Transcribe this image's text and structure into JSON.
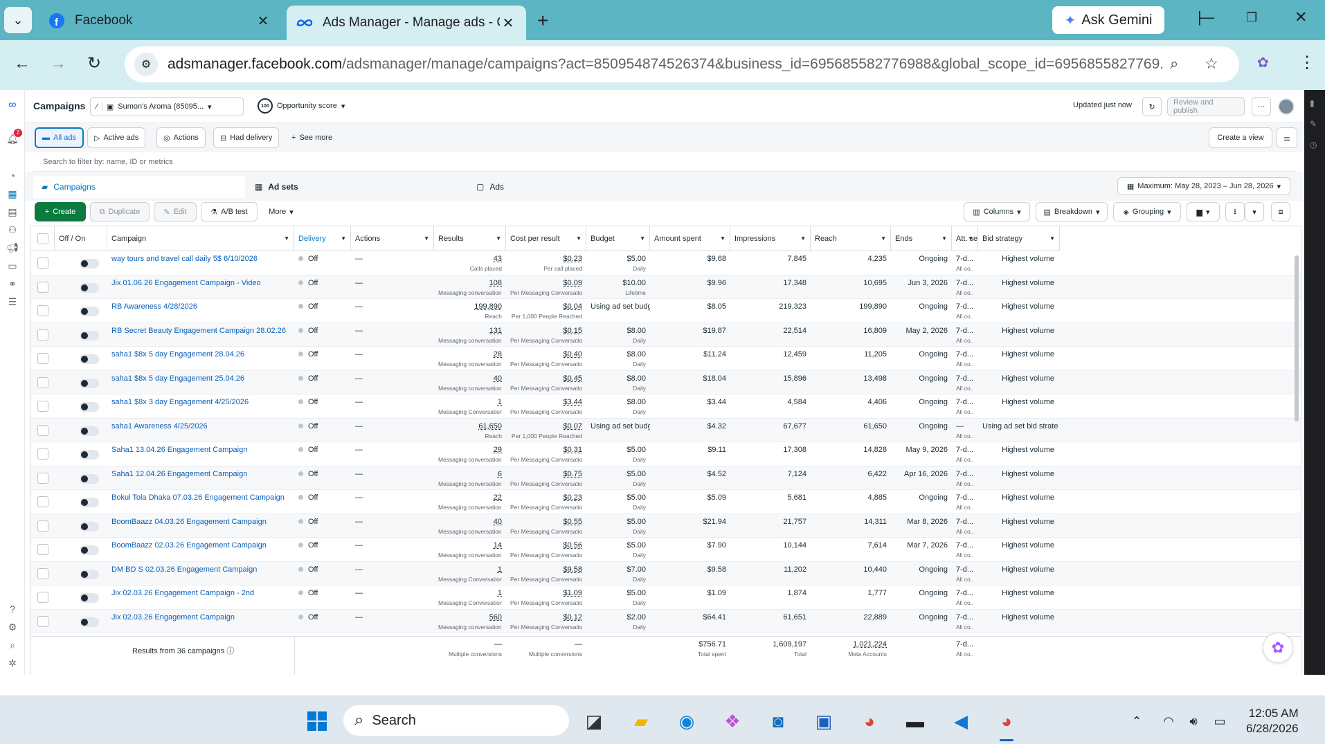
{
  "browser": {
    "tabs": [
      {
        "title": "Facebook"
      },
      {
        "title": "Ads Manager - Manage ads - C"
      }
    ],
    "gemini": "Ask Gemini",
    "url_domain": "adsmanager.facebook.com",
    "url_path": "/adsmanager/manage/campaigns?act=850954874526374&business_id=695685582776988&global_scope_id=6956855827769..."
  },
  "header": {
    "title": "Campaigns",
    "account": "Sumon's Aroma (85095...",
    "score_badge": "100",
    "opportunity": "Opportunity score",
    "updated": "Updated just now",
    "review": "Review and publish",
    "more": "···",
    "notif_count": "2"
  },
  "filters": {
    "all_ads": "All ads",
    "active_ads": "Active ads",
    "actions": "Actions",
    "had_delivery": "Had delivery",
    "see_more": "See more",
    "create_view": "Create a view",
    "search_placeholder": "Search to filter by: name, ID or metrics"
  },
  "levels": {
    "campaigns": "Campaigns",
    "adsets": "Ad sets",
    "ads": "Ads",
    "date": "Maximum: May 28, 2023 – Jun 28, 2026"
  },
  "toolbar": {
    "create": "Create",
    "duplicate": "Duplicate",
    "edit": "Edit",
    "abtest": "A/B test",
    "more": "More",
    "columns": "Columns",
    "breakdown": "Breakdown",
    "grouping": "Grouping"
  },
  "columns": [
    "Off / On",
    "Campaign",
    "Delivery",
    "Actions",
    "Results",
    "Cost per result",
    "Budget",
    "Amount spent",
    "Impressions",
    "Reach",
    "Ends",
    "Att. set...",
    "Bid strategy"
  ],
  "rows": [
    {
      "campaign": "way tours and travel call daily 5$ 6/10/2026",
      "delivery": "Off",
      "actions": "—",
      "results": "43",
      "results_sub": "Calls placed",
      "cpr": "$0.23",
      "cpr_sub": "Per call placed",
      "budget": "$5.00",
      "budget_sub": "Daily",
      "spent": "$9.68",
      "impr": "7,845",
      "reach": "4,235",
      "ends": "Ongoing",
      "att": "7-d...",
      "att_sub": "All co...",
      "bid": "Highest volume"
    },
    {
      "campaign": "Jix 01.06.26 Engagement Campaign - Video",
      "delivery": "Off",
      "actions": "—",
      "results": "108",
      "results_sub": "Messaging conversation...",
      "cpr": "$0.09",
      "cpr_sub": "Per Messaging Conversation ...",
      "budget": "$10.00",
      "budget_sub": "Lifetime",
      "spent": "$9.96",
      "impr": "17,348",
      "reach": "10,695",
      "ends": "Jun 3, 2026",
      "att": "7-d...",
      "att_sub": "All co...",
      "bid": "Highest volume"
    },
    {
      "campaign": "RB Awareness 4/28/2026",
      "delivery": "Off",
      "actions": "—",
      "results": "199,890",
      "results_sub": "Reach",
      "cpr": "$0.04",
      "cpr_sub": "Per 1,000 People Reached",
      "budget": "Using ad set budget",
      "budget_sub": "",
      "spent": "$8.05",
      "impr": "219,323",
      "reach": "199,890",
      "ends": "Ongoing",
      "att": "7-d...",
      "att_sub": "All co...",
      "bid": "Highest volume"
    },
    {
      "campaign": "RB Secret Beauty Engagement Campaign 28.02.26",
      "delivery": "Off",
      "actions": "—",
      "results": "131",
      "results_sub": "Messaging conversation...",
      "cpr": "$0.15",
      "cpr_sub": "Per Messaging Conversation ...",
      "budget": "$8.00",
      "budget_sub": "Daily",
      "spent": "$19.87",
      "impr": "22,514",
      "reach": "16,809",
      "ends": "May 2, 2026",
      "att": "7-d...",
      "att_sub": "All co...",
      "bid": "Highest volume"
    },
    {
      "campaign": "saha1 $8x 5 day Engagement 28.04.26",
      "delivery": "Off",
      "actions": "—",
      "results": "28",
      "results_sub": "Messaging conversation...",
      "cpr": "$0.40",
      "cpr_sub": "Per Messaging Conversation ...",
      "budget": "$8.00",
      "budget_sub": "Daily",
      "spent": "$11.24",
      "impr": "12,459",
      "reach": "11,205",
      "ends": "Ongoing",
      "att": "7-d...",
      "att_sub": "All co...",
      "bid": "Highest volume"
    },
    {
      "campaign": "saha1 $8x 5 day Engagement 25.04.26",
      "delivery": "Off",
      "actions": "—",
      "results": "40",
      "results_sub": "Messaging conversation...",
      "cpr": "$0.45",
      "cpr_sub": "Per Messaging Conversation ...",
      "budget": "$8.00",
      "budget_sub": "Daily",
      "spent": "$18.04",
      "impr": "15,896",
      "reach": "13,498",
      "ends": "Ongoing",
      "att": "7-d...",
      "att_sub": "All co...",
      "bid": "Highest volume"
    },
    {
      "campaign": "saha1 $8x 3 day Engagement 4/25/2026",
      "delivery": "Off",
      "actions": "—",
      "results": "1",
      "results_sub": "Messaging Conversation...",
      "cpr": "$3.44",
      "cpr_sub": "Per Messaging Conversation ...",
      "budget": "$8.00",
      "budget_sub": "Daily",
      "spent": "$3.44",
      "impr": "4,584",
      "reach": "4,406",
      "ends": "Ongoing",
      "att": "7-d...",
      "att_sub": "All co...",
      "bid": "Highest volume"
    },
    {
      "campaign": "saha1 Awareness 4/25/2026",
      "delivery": "Off",
      "actions": "—",
      "results": "61,650",
      "results_sub": "Reach",
      "cpr": "$0.07",
      "cpr_sub": "Per 1,000 People Reached",
      "budget": "Using ad set budget",
      "budget_sub": "",
      "spent": "$4.32",
      "impr": "67,677",
      "reach": "61,650",
      "ends": "Ongoing",
      "att": "—",
      "att_sub": "All co...",
      "bid": "Using ad set bid strategy"
    },
    {
      "campaign": "Saha1 13.04.26 Engagement Campaign",
      "delivery": "Off",
      "actions": "—",
      "results": "29",
      "results_sub": "Messaging conversation...",
      "cpr": "$0.31",
      "cpr_sub": "Per Messaging Conversation ...",
      "budget": "$5.00",
      "budget_sub": "Daily",
      "spent": "$9.11",
      "impr": "17,308",
      "reach": "14,828",
      "ends": "May 9, 2026",
      "att": "7-d...",
      "att_sub": "All co...",
      "bid": "Highest volume"
    },
    {
      "campaign": "Saha1 12.04.26 Engagement Campaign",
      "delivery": "Off",
      "actions": "—",
      "results": "6",
      "results_sub": "Messaging conversation...",
      "cpr": "$0.75",
      "cpr_sub": "Per Messaging Conversation ...",
      "budget": "$5.00",
      "budget_sub": "Daily",
      "spent": "$4.52",
      "impr": "7,124",
      "reach": "6,422",
      "ends": "Apr 16, 2026",
      "att": "7-d...",
      "att_sub": "All co...",
      "bid": "Highest volume"
    },
    {
      "campaign": "Bokul Tola Dhaka 07.03.26 Engagement Campaign",
      "delivery": "Off",
      "actions": "—",
      "results": "22",
      "results_sub": "Messaging conversation...",
      "cpr": "$0.23",
      "cpr_sub": "Per Messaging Conversation ...",
      "budget": "$5.00",
      "budget_sub": "Daily",
      "spent": "$5.09",
      "impr": "5,681",
      "reach": "4,885",
      "ends": "Ongoing",
      "att": "7-d...",
      "att_sub": "All co...",
      "bid": "Highest volume"
    },
    {
      "campaign": "BoomBaazz 04.03.26 Engagement Campaign",
      "delivery": "Off",
      "actions": "—",
      "results": "40",
      "results_sub": "Messaging conversation...",
      "cpr": "$0.55",
      "cpr_sub": "Per Messaging Conversation ...",
      "budget": "$5.00",
      "budget_sub": "Daily",
      "spent": "$21.94",
      "impr": "21,757",
      "reach": "14,311",
      "ends": "Mar 8, 2026",
      "att": "7-d...",
      "att_sub": "All co...",
      "bid": "Highest volume"
    },
    {
      "campaign": "BoomBaazz 02.03.26 Engagement Campaign",
      "delivery": "Off",
      "actions": "—",
      "results": "14",
      "results_sub": "Messaging conversation...",
      "cpr": "$0.56",
      "cpr_sub": "Per Messaging Conversation ...",
      "budget": "$5.00",
      "budget_sub": "Daily",
      "spent": "$7.90",
      "impr": "10,144",
      "reach": "7,614",
      "ends": "Mar 7, 2026",
      "att": "7-d...",
      "att_sub": "All co...",
      "bid": "Highest volume"
    },
    {
      "campaign": "DM BD S 02.03.26 Engagement Campaign",
      "delivery": "Off",
      "actions": "—",
      "results": "1",
      "results_sub": "Messaging Conversation...",
      "cpr": "$9.58",
      "cpr_sub": "Per Messaging Conversation ...",
      "budget": "$7.00",
      "budget_sub": "Daily",
      "spent": "$9.58",
      "impr": "11,202",
      "reach": "10,440",
      "ends": "Ongoing",
      "att": "7-d...",
      "att_sub": "All co...",
      "bid": "Highest volume"
    },
    {
      "campaign": "Jix 02.03.26 Engagement Campaign - 2nd",
      "delivery": "Off",
      "actions": "—",
      "results": "1",
      "results_sub": "Messaging Conversation...",
      "cpr": "$1.09",
      "cpr_sub": "Per Messaging Conversation ...",
      "budget": "$5.00",
      "budget_sub": "Daily",
      "spent": "$1.09",
      "impr": "1,874",
      "reach": "1,777",
      "ends": "Ongoing",
      "att": "7-d...",
      "att_sub": "All co...",
      "bid": "Highest volume"
    },
    {
      "campaign": "Jix 02.03.26 Engagement Campaign",
      "delivery": "Off",
      "actions": "—",
      "results": "560",
      "results_sub": "Messaging conversation...",
      "cpr": "$0.12",
      "cpr_sub": "Per Messaging Conversation ...",
      "budget": "$2.00",
      "budget_sub": "Daily",
      "spent": "$64.41",
      "impr": "61,651",
      "reach": "22,889",
      "ends": "Ongoing",
      "att": "7-d...",
      "att_sub": "All co...",
      "bid": "Highest volume"
    }
  ],
  "footer": {
    "label": "Results from 36 campaigns",
    "results": "—",
    "results_sub": "Multiple conversions",
    "cpr": "—",
    "cpr_sub": "Multiple conversions",
    "spent": "$756.71",
    "spent_sub": "Total spent",
    "impr": "1,609,197",
    "impr_sub": "Total",
    "reach": "1,021,224",
    "reach_sub": "Meta Accounts",
    "att": "7-d...",
    "att_sub": "All co..."
  },
  "taskbar": {
    "search": "Search",
    "time": "12:05 AM",
    "date": "6/28/2026"
  }
}
